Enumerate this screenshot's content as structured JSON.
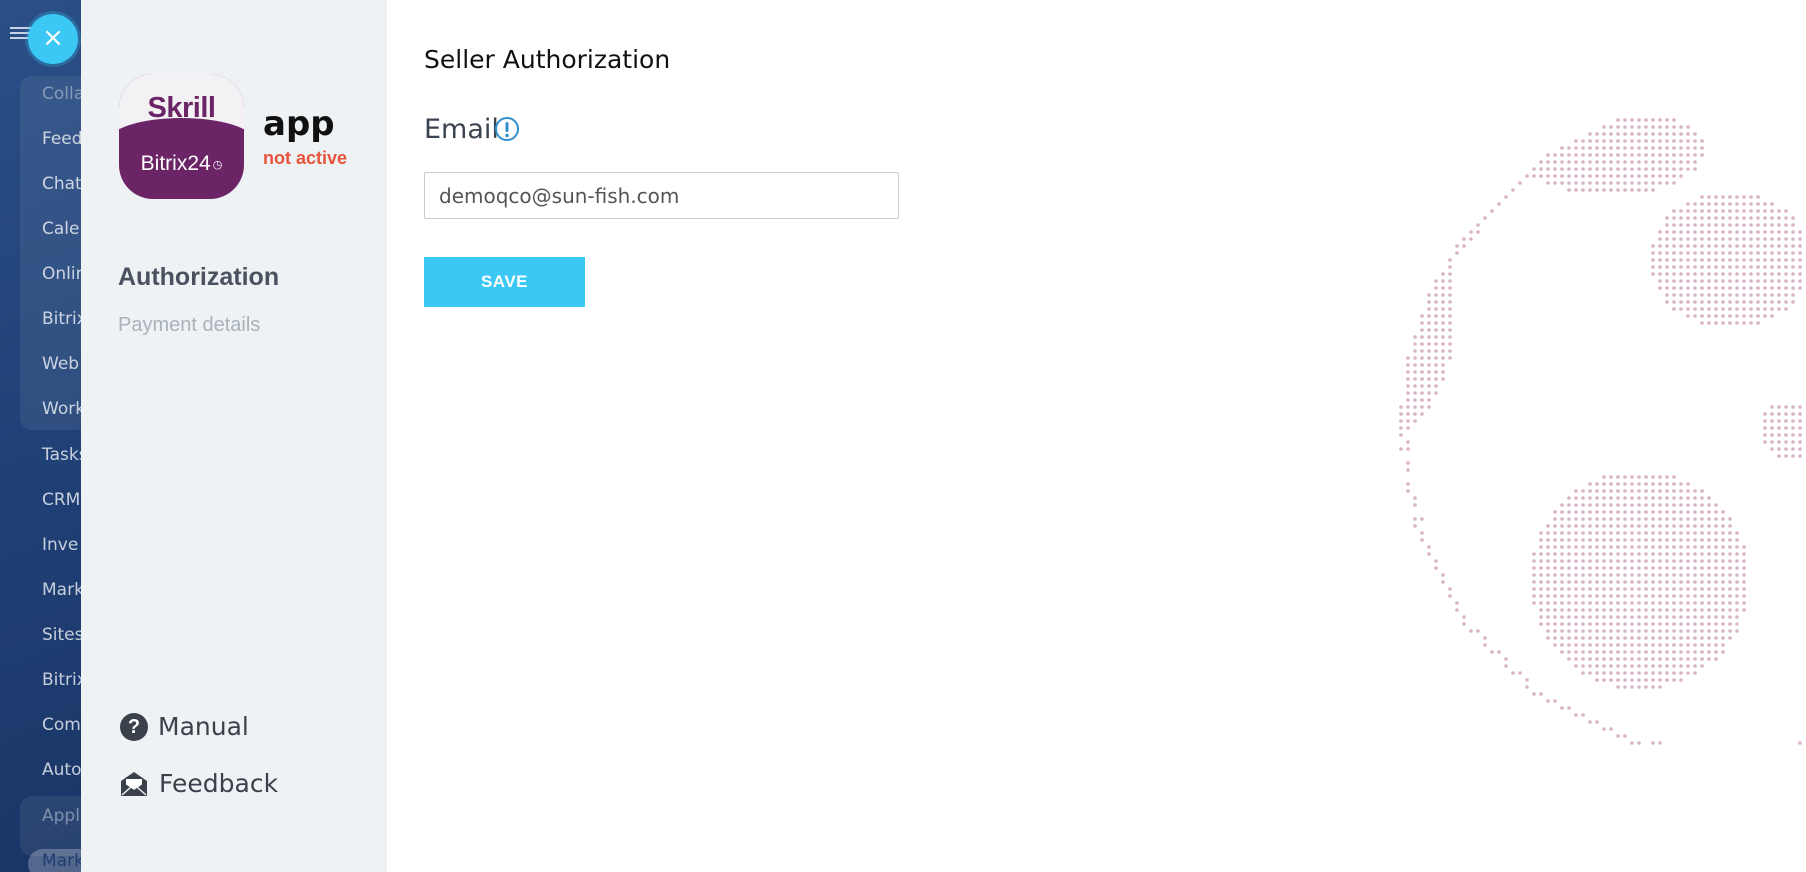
{
  "background_nav": {
    "items": [
      "Colla",
      "Feed",
      "Chat",
      "Cale",
      "Onlin",
      "Bitrix",
      "Web",
      "Work",
      "Tasks",
      "CRM",
      "Inve",
      "Mark",
      "Sites",
      "Bitrix",
      "Com",
      "Auto",
      "Appl",
      "Mark"
    ]
  },
  "close_button": {
    "label": "×"
  },
  "app": {
    "logo_top": "Skrill",
    "logo_bottom": "Bitrix24",
    "name": "app",
    "status": "not active"
  },
  "sidebar": {
    "nav": [
      {
        "label": "Authorization",
        "active": true
      },
      {
        "label": "Payment details",
        "active": false
      }
    ],
    "manual_label": "Manual",
    "feedback_label": "Feedback",
    "manual_icon_glyph": "?"
  },
  "main": {
    "title": "Seller Authorization",
    "email_label": "Email",
    "email_value": "demoqco@sun-fish.com",
    "save_label": "SAVE"
  },
  "colors": {
    "accent": "#3bc8f5",
    "status_inactive": "#e8533c",
    "brand": "#6b2566",
    "sidebar_bg": "#eef2f4"
  },
  "icons": [
    "close-icon",
    "menu-icon",
    "info-icon",
    "question-icon",
    "envelope-icon",
    "globe-illustration"
  ]
}
